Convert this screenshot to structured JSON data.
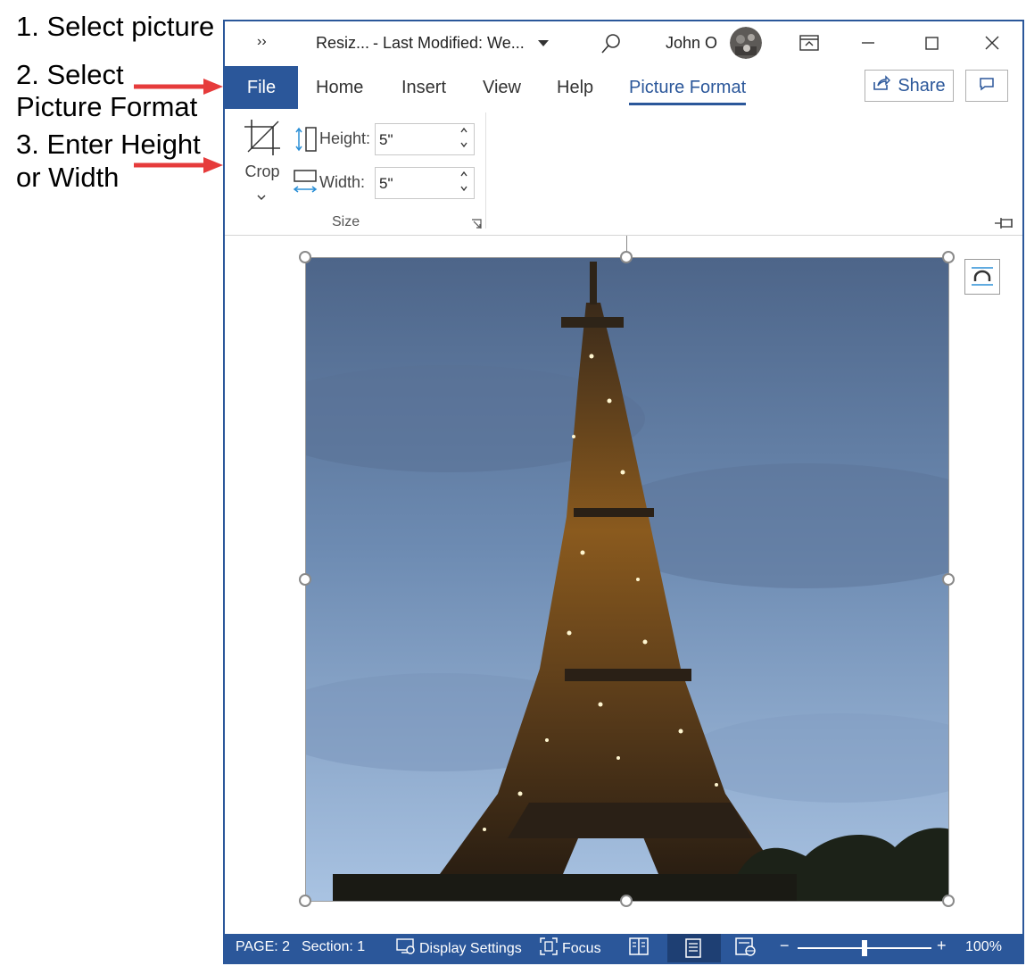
{
  "annotations": {
    "step1": "1. Select picture",
    "step2_line1": "2. Select",
    "step2_line2": "Picture Format",
    "step3_line1": "3. Enter Height",
    "step3_line2": "or Width"
  },
  "titlebar": {
    "overflow": "››",
    "doc_name": "Resiz...",
    "last_modified": "-  Last Modified: We...",
    "user_name": "John O"
  },
  "tabs": [
    "File",
    "Home",
    "Insert",
    "View",
    "Help",
    "Picture Format"
  ],
  "active_tab": "Picture Format",
  "share_label": "Share",
  "ribbon": {
    "crop_label": "Crop",
    "height_label": "Height:",
    "height_value": "5\"",
    "width_label": "Width:",
    "width_value": "5\"",
    "size_group": "Size"
  },
  "status": {
    "page": "PAGE: 2",
    "section": "Section: 1",
    "display_settings": "Display Settings",
    "focus": "Focus",
    "zoom_minus": "−",
    "zoom_plus": "+",
    "zoom": "100%",
    "zoom_level_fraction": 0.5
  },
  "colors": {
    "accent": "#2b579a",
    "annotation_arrow": "#e63b3b"
  },
  "icons": [
    "overflow-icon",
    "dropdown-icon",
    "search-icon",
    "avatar",
    "display-mode-icon",
    "minimize-icon",
    "maximize-icon",
    "close-icon",
    "share-icon",
    "comment-icon",
    "crop-icon",
    "height-icon",
    "width-icon",
    "dialog-launcher-icon",
    "pin-icon",
    "layout-options-icon",
    "display-settings-icon",
    "focus-icon",
    "read-mode-icon",
    "print-layout-icon",
    "web-layout-icon"
  ]
}
